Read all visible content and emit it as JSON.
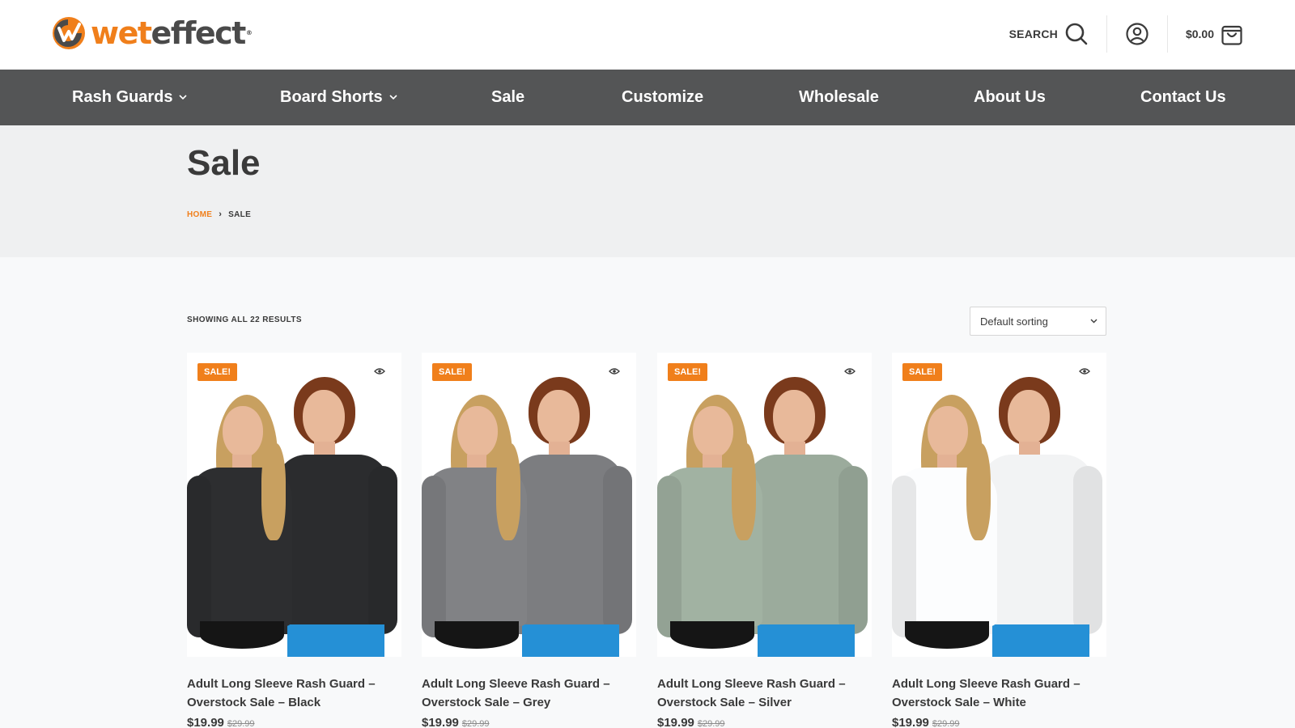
{
  "brand": {
    "name_part1": "wet",
    "name_part2": "effect",
    "mark": "®",
    "accent_color": "#f07f1b"
  },
  "header": {
    "search_label": "SEARCH",
    "cart_total": "$0.00"
  },
  "nav": {
    "items": [
      {
        "label": "Rash Guards",
        "has_dropdown": true
      },
      {
        "label": "Board Shorts",
        "has_dropdown": true
      },
      {
        "label": "Sale",
        "has_dropdown": false
      },
      {
        "label": "Customize",
        "has_dropdown": false
      },
      {
        "label": "Wholesale",
        "has_dropdown": false
      },
      {
        "label": "About Us",
        "has_dropdown": false
      },
      {
        "label": "Contact Us",
        "has_dropdown": false
      }
    ]
  },
  "page": {
    "title": "Sale",
    "breadcrumb": {
      "home": "HOME",
      "separator": "›",
      "current": "SALE"
    }
  },
  "shop": {
    "results_text": "SHOWING ALL 22 RESULTS",
    "sort_selected": "Default sorting"
  },
  "products": [
    {
      "badge": "SALE!",
      "title_line1": "Adult Long Sleeve Rash Guard –",
      "title_line2": "Overstock Sale – Black",
      "price": "$19.99",
      "old_price": "$29.99",
      "shirt_color": "#2b2c2e"
    },
    {
      "badge": "SALE!",
      "title_line1": "Adult Long Sleeve Rash Guard –",
      "title_line2": "Overstock Sale – Grey",
      "price": "$19.99",
      "old_price": "$29.99",
      "shirt_color": "#7c7d80"
    },
    {
      "badge": "SALE!",
      "title_line1": "Adult Long Sleeve Rash Guard –",
      "title_line2": "Overstock Sale – Silver",
      "price": "$19.99",
      "old_price": "$29.99",
      "shirt_color": "#9bab9c"
    },
    {
      "badge": "SALE!",
      "title_line1": "Adult Long Sleeve Rash Guard –",
      "title_line2": "Overstock Sale – White",
      "price": "$19.99",
      "old_price": "$29.99",
      "shirt_color": "#f2f3f4"
    }
  ]
}
